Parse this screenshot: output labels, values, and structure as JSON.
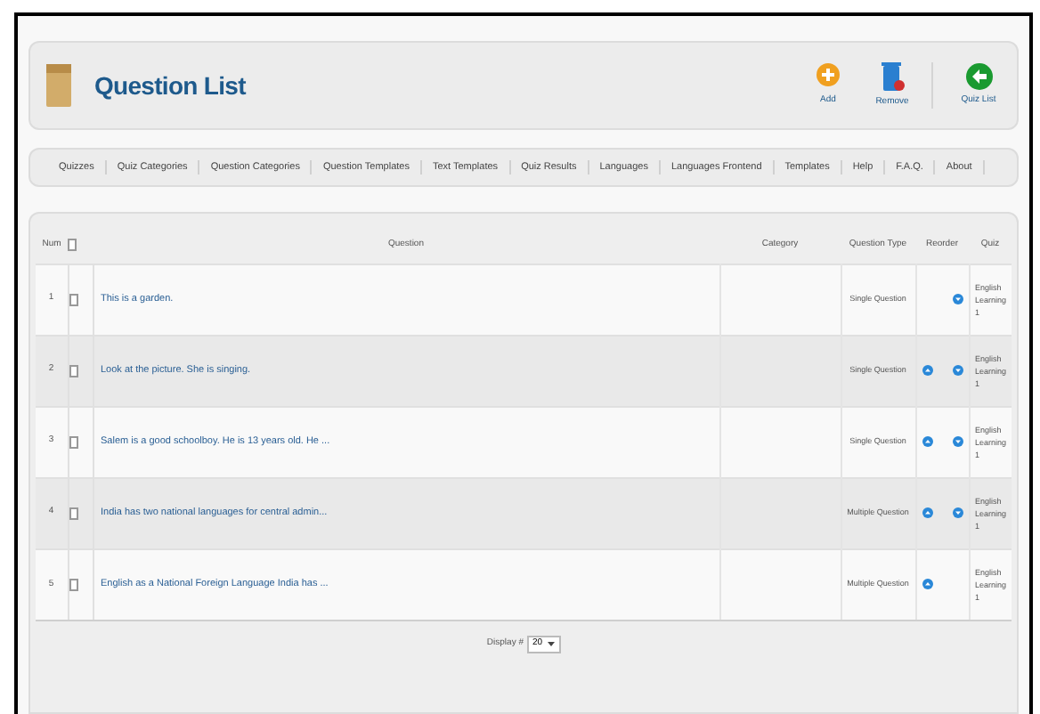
{
  "header": {
    "title": "Question List",
    "actions": [
      {
        "kind": "add",
        "label": "Add"
      },
      {
        "kind": "remove",
        "label": "Remove"
      },
      {
        "kind": "back",
        "label": "Quiz List"
      }
    ]
  },
  "nav": [
    "Quizzes",
    "Quiz Categories",
    "Question Categories",
    "Question Templates",
    "Text Templates",
    "Quiz Results",
    "Languages",
    "Languages Frontend",
    "Templates",
    "Help",
    "F.A.Q.",
    "About"
  ],
  "table": {
    "columns": [
      "Num",
      "Question",
      "Category",
      "Question Type",
      "Reorder",
      "Quiz"
    ],
    "rows": [
      {
        "num": "1",
        "question": "This is a garden.",
        "type": "Single Question",
        "up": false,
        "down": true,
        "quiz": "English Learning 1"
      },
      {
        "num": "2",
        "question": "Look at the picture. She is singing.",
        "type": "Single Question",
        "up": true,
        "down": true,
        "quiz": "English Learning 1"
      },
      {
        "num": "3",
        "question": "Salem is a good schoolboy. He is 13 years old. He ...",
        "type": "Single Question",
        "up": true,
        "down": true,
        "quiz": "English Learning 1"
      },
      {
        "num": "4",
        "question": "India has two national languages for central admin...",
        "type": "Multiple Question",
        "up": true,
        "down": true,
        "quiz": "English Learning 1"
      },
      {
        "num": "5",
        "question": "English as a National Foreign Language India has ...",
        "type": "Multiple Question",
        "up": true,
        "down": false,
        "quiz": "English Learning 1"
      }
    ]
  },
  "footer": {
    "label": "Display #",
    "value": "20"
  }
}
